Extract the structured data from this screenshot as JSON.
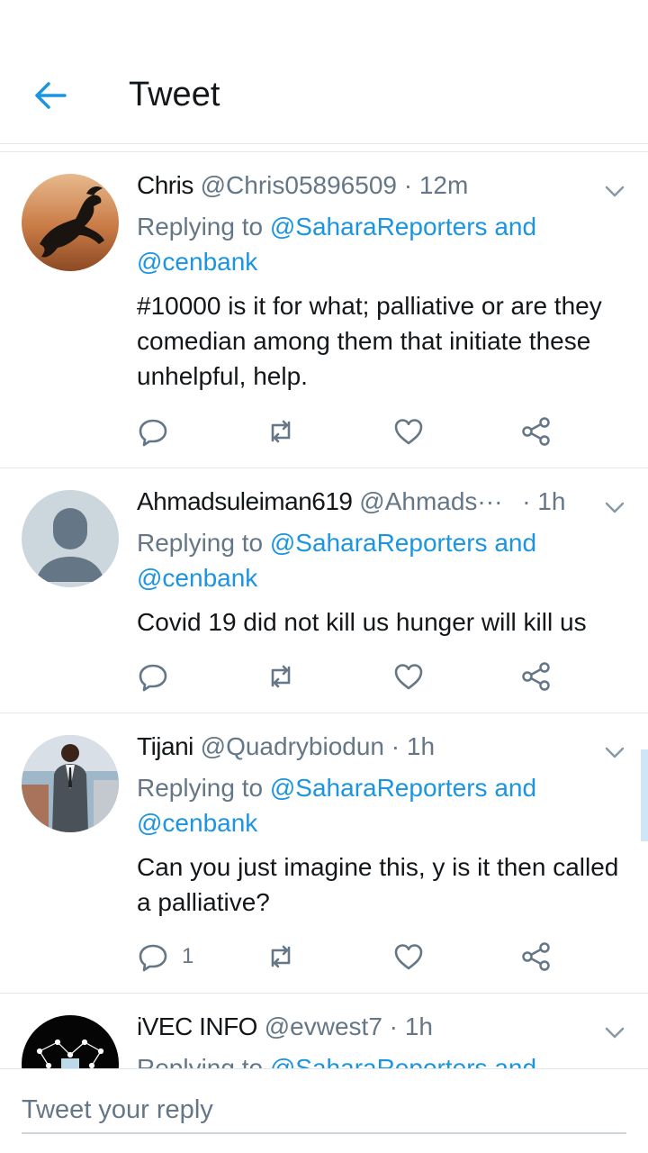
{
  "header": {
    "title": "Tweet"
  },
  "tweets": [
    {
      "name": "Chris",
      "handle": "@Chris05896509",
      "time": "· 12m",
      "replying_prefix": "Replying to",
      "mention_1": "@SaharaReporters",
      "and_word": "and",
      "mention_2": "@cenbank",
      "text": "#10000 is it for what; palliative or are they comedian among them that initiate these unhelpful, help.",
      "avatar_icon": "horse-avatar",
      "reply_count": ""
    },
    {
      "name": "Ahmadsuleiman619",
      "handle": "@Ahmads···",
      "time": "· 1h",
      "replying_prefix": "Replying to",
      "mention_1": "@SaharaReporters",
      "and_word": "and",
      "mention_2": "@cenbank",
      "text": "Covid 19 did not kill us hunger will kill us",
      "avatar_icon": "default-profile-avatar",
      "reply_count": ""
    },
    {
      "name": "Tijani",
      "handle": "@Quadrybiodun",
      "time": "· 1h",
      "replying_prefix": "Replying to",
      "mention_1": "@SaharaReporters",
      "and_word": "and",
      "mention_2": "@cenbank",
      "text": "Can you just imagine this, y is it then called a palliative?",
      "avatar_icon": "person-photo-avatar",
      "reply_count": "1"
    },
    {
      "name": "iVEC INFO",
      "handle": "@evwest7",
      "time": "· 1h",
      "replying_prefix": "Replying to",
      "mention_1": "@SaharaReporters",
      "and_word": "and",
      "avatar_icon": "network-logo-avatar"
    }
  ],
  "composer": {
    "placeholder": "Tweet your reply"
  },
  "colors": {
    "accent": "#1b95e0",
    "secondary_text": "#657786",
    "divider": "#e1e8ed"
  }
}
